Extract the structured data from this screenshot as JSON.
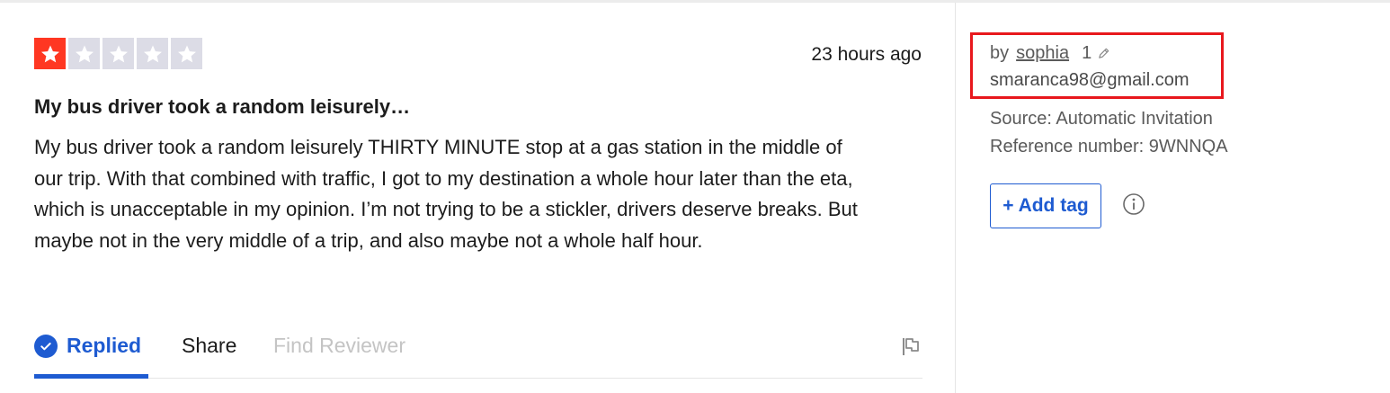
{
  "review": {
    "rating": 1,
    "max_rating": 5,
    "time_ago": "23 hours ago",
    "title": "My bus driver took a random leisurely…",
    "body": "My bus driver took a random leisurely THIRTY MINUTE stop at a gas station in the middle of our trip. With that combined with traffic, I got to my destination a whole hour later than the eta, which is unacceptable in my opinion. I’m not trying to be a stickler, drivers deserve breaks. But maybe not in the very middle of a trip, and also maybe not a whole half hour."
  },
  "actions": {
    "replied": "Replied",
    "share": "Share",
    "find_reviewer": "Find Reviewer"
  },
  "sidebar": {
    "by_prefix": "by",
    "author": "sophia",
    "review_count": "1",
    "email": "smaranca98@gmail.com",
    "source": "Source: Automatic Invitation",
    "reference": "Reference number: 9WNNQA",
    "add_tag": "+ Add tag"
  },
  "colors": {
    "star_filled": "#ff3722",
    "star_empty": "#dcdce6",
    "accent_blue": "#1e5bd1",
    "highlight_red": "#e8181d"
  },
  "icons": [
    "star-icon",
    "check-circle-icon",
    "flag-icon",
    "pencil-icon",
    "info-icon"
  ]
}
